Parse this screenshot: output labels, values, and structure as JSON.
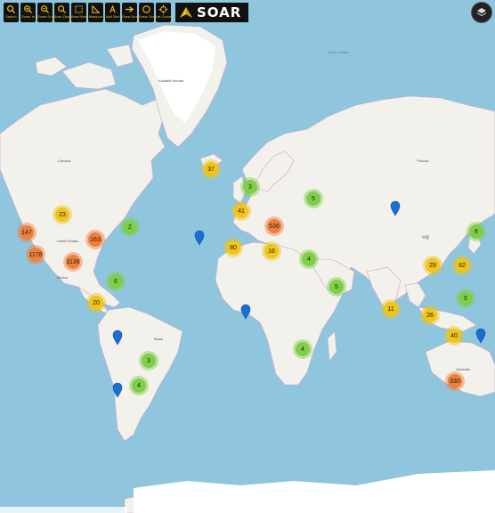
{
  "brand": {
    "name": "SOAR"
  },
  "toolbar": {
    "tools": [
      {
        "label": "Search",
        "icon": "search-icon"
      },
      {
        "label": "Zoom In",
        "icon": "zoom-in-icon"
      },
      {
        "label": "Zoom Out",
        "icon": "zoom-out-icon"
      },
      {
        "label": "Area Zoom",
        "icon": "area-zoom-icon"
      },
      {
        "label": "Area Measure",
        "icon": "area-measure-icon"
      },
      {
        "label": "Measure",
        "icon": "measure-icon"
      },
      {
        "label": "Add Text",
        "icon": "add-text-icon"
      },
      {
        "label": "Draw Arrow",
        "icon": "arrow-icon"
      },
      {
        "label": "Draw Circle",
        "icon": "circle-icon"
      },
      {
        "label": "Lat Coord",
        "icon": "crosshair-icon"
      }
    ]
  },
  "clusters": [
    {
      "count": "37",
      "level": "medium"
    },
    {
      "count": "3",
      "level": "small"
    },
    {
      "count": "5",
      "level": "small"
    },
    {
      "count": "23",
      "level": "medium"
    },
    {
      "count": "41",
      "level": "medium"
    },
    {
      "count": "536",
      "level": "large"
    },
    {
      "count": "147",
      "level": "large"
    },
    {
      "count": "163",
      "level": "large"
    },
    {
      "count": "2",
      "level": "small"
    },
    {
      "count": "1178",
      "level": "large"
    },
    {
      "count": "1136",
      "level": "large"
    },
    {
      "count": "80",
      "level": "medium"
    },
    {
      "count": "16",
      "level": "medium"
    },
    {
      "count": "4",
      "level": "small"
    },
    {
      "count": "8",
      "level": "small"
    },
    {
      "count": "29",
      "level": "medium"
    },
    {
      "count": "82",
      "level": "medium"
    },
    {
      "count": "6",
      "level": "small"
    },
    {
      "count": "5",
      "level": "small"
    },
    {
      "count": "5",
      "level": "small"
    },
    {
      "count": "20",
      "level": "medium"
    },
    {
      "count": "11",
      "level": "medium"
    },
    {
      "count": "26",
      "level": "medium"
    },
    {
      "count": "40",
      "level": "medium"
    },
    {
      "count": "3",
      "level": "small"
    },
    {
      "count": "4",
      "level": "small"
    },
    {
      "count": "4",
      "level": "small"
    },
    {
      "count": "330",
      "level": "large"
    }
  ],
  "pins": 7,
  "colors": {
    "small": "#7fce4a",
    "medium": "#f0c419",
    "large": "#f07f3c",
    "pin": "#1a6fd1",
    "land": "#f3f1ec",
    "ice": "#ffffff",
    "water": "#8fc6dd"
  },
  "labels": {
    "greenland": "Kalaallit Nunaat",
    "canada": "Canada",
    "usa": "United States",
    "mexico": "México",
    "brazil": "Brasil",
    "russia": "Россия",
    "china": "中国",
    "australia": "Australia",
    "arctic": "Arctic Ocean"
  }
}
